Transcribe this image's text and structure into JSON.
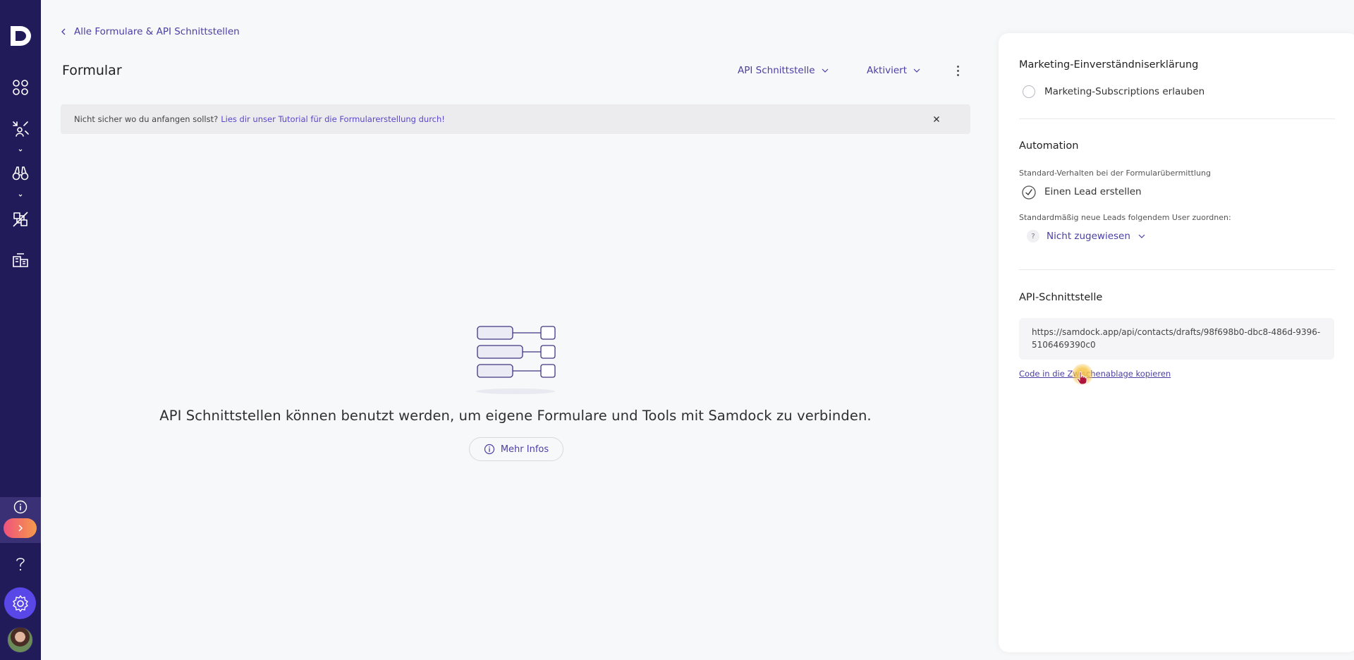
{
  "breadcrumb": {
    "label": "Alle Formulare & API Schnittstellen"
  },
  "header": {
    "title": "Formular",
    "type_dropdown": "API Schnittstelle",
    "status_dropdown": "Aktiviert"
  },
  "banner": {
    "text": "Nicht sicher wo du anfangen sollst?",
    "link": "Lies dir unser Tutorial für die Formularerstellung durch!"
  },
  "empty_state": {
    "text": "API Schnittstellen können benutzt werden, um eigene Formulare und Tools mit Samdock zu verbinden.",
    "button": "Mehr Infos"
  },
  "panel": {
    "marketing": {
      "title": "Marketing-Einverständniserklärung",
      "option": "Marketing-Subscriptions erlauben",
      "checked": false
    },
    "automation": {
      "title": "Automation",
      "default_behavior_label": "Standard-Verhalten bei der Formularübermittlung",
      "default_behavior_value": "Einen Lead erstellen",
      "assign_label": "Standardmäßig neue Leads folgendem User zuordnen:",
      "assign_value": "Nicht zugewiesen",
      "assign_avatar": "?"
    },
    "api": {
      "title": "API-Schnittstelle",
      "url": "https://samdock.app/api/contacts/drafts/98f698b0-dbc8-486d-9396-5106469390c0",
      "copy_link": "Code in die Zwischenablage kopieren"
    }
  },
  "colors": {
    "sidebar": "#221b5a",
    "accent": "#4a3fa3",
    "settings_button": "#5a47e8",
    "pill_gradient_start": "#f0517c",
    "pill_gradient_end": "#f59b4b"
  },
  "icons": {
    "sidebar": [
      "logo-icon",
      "dashboard-icon",
      "contacts-icon",
      "binoculars-icon",
      "pipeline-icon",
      "building-icon",
      "info-icon",
      "chevron-right-icon",
      "help-icon",
      "gear-icon"
    ]
  }
}
